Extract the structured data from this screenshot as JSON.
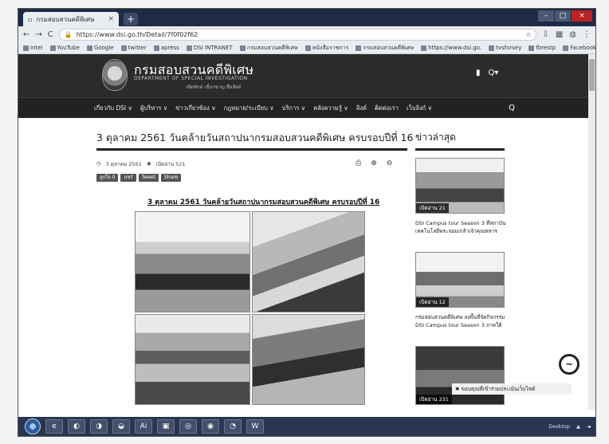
{
  "browser": {
    "tab_title": "กรมสอบสวนคดีพิเศษ",
    "url": "https://www.dsi.go.th/Detail/7f0f02f62",
    "bookmarks": [
      "Intel",
      "YouTube",
      "Google",
      "twitter",
      "apress",
      "DSI INTRANET",
      "กรมสอบสวนคดีพิเศษ",
      "หนังสือราชการ",
      "กรมสอบสวนคดีพิเศษ",
      "https://www.dsi.go.",
      "tvsforsey",
      "fbrestp",
      "Facebook - เข้าสู่ระบบ"
    ]
  },
  "site": {
    "title": "กรมสอบสวนคดีพิเศษ",
    "subtitle": "DEPARTMENT OF SPECIAL INVESTIGATION",
    "tagline": "เทิดทักษ์ เชี่ยวชาญ ซื่อสัตย์"
  },
  "nav": {
    "items": [
      "เกี่ยวกับ DSI ∨",
      "ผู้บริหาร ∨",
      "ข่าวเกี่ยวข้อง ∨",
      "กฎหมาย/ระเบียบ ∨",
      "บริการ ∨",
      "คลังความรู้ ∨",
      "ลิงค์",
      "ติดต่อเรา",
      "เว็บลิงก์ ∨"
    ]
  },
  "post": {
    "title": "3 ตุลาคม 2561 วันคล้ายวันสถาปนากรมสอบสวนคดีพิเศษ ครบรอบปีที่ 16",
    "date": "3 ตุลาคม 2561",
    "views": "เปิดอ่าน 521",
    "share": [
      "ถูกใจ 0",
      "แชร์",
      "Tweet",
      "Share"
    ],
    "heading": "3 ตุลาคม 2561 วันคล้ายวันสถาปนากรมสอบสวนคดีพิเศษ ครบรอบปีที่ 16"
  },
  "sidebar": {
    "title": "ข่าวล่าสุด",
    "items": [
      {
        "views": "เปิดอ่าน 21",
        "caption": "DSI Campus tour Season 3 ที่สถาบันเทคโนโลยีพระจอมเกล้าเจ้าคุณทหาร"
      },
      {
        "views": "เปิดอ่าน 12",
        "caption": "กรมสอบสวนคดีพิเศษ ลงพื้นที่จัดกิจกรรม DSI Campus tour Season 3 ภาคใต้"
      },
      {
        "views": "เปิดอ่าน 231",
        "caption": ""
      }
    ]
  },
  "cookie_text": "ขอบคุณที่เข้าร่วมประเมินเว็บไซต์",
  "taskbar": {
    "items": [
      "e",
      "◐",
      "◑",
      "◒",
      "Ai",
      "▣",
      "◎",
      "◉",
      "◔",
      "W"
    ],
    "tray_text": "Desktop"
  },
  "colors": {
    "header_bg": "#2b2b2b",
    "nav_bg": "#222222",
    "chrome_dark": "#1d2b45"
  }
}
